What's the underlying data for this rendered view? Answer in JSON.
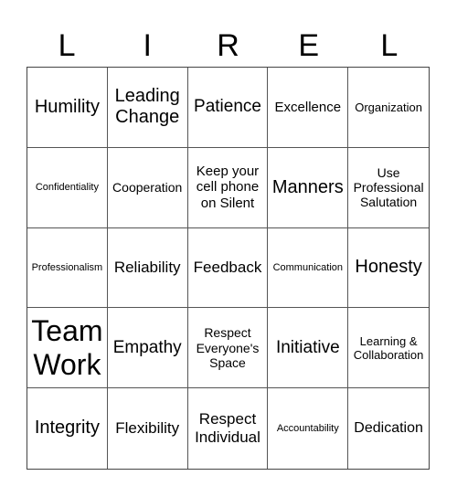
{
  "card": {
    "header_letters": [
      "L",
      "I",
      "R",
      "E",
      "L"
    ],
    "rows": [
      [
        "Humility",
        "Leading Change",
        "Patience",
        "Excellence",
        "Organization"
      ],
      [
        "Confidentiality",
        "Cooperation",
        "Keep your cell phone on Silent",
        "Manners",
        "Use Professional Salutation"
      ],
      [
        "Professionalism",
        "Reliability",
        "Feedback",
        "Communication",
        "Honesty"
      ],
      [
        "Team Work",
        "Empathy",
        "Respect Everyone's Space",
        "Initiative",
        "Learning & Collaboration"
      ],
      [
        "Integrity",
        "Flexibility",
        "Respect Individual",
        "Accountability",
        "Dedication"
      ]
    ]
  }
}
